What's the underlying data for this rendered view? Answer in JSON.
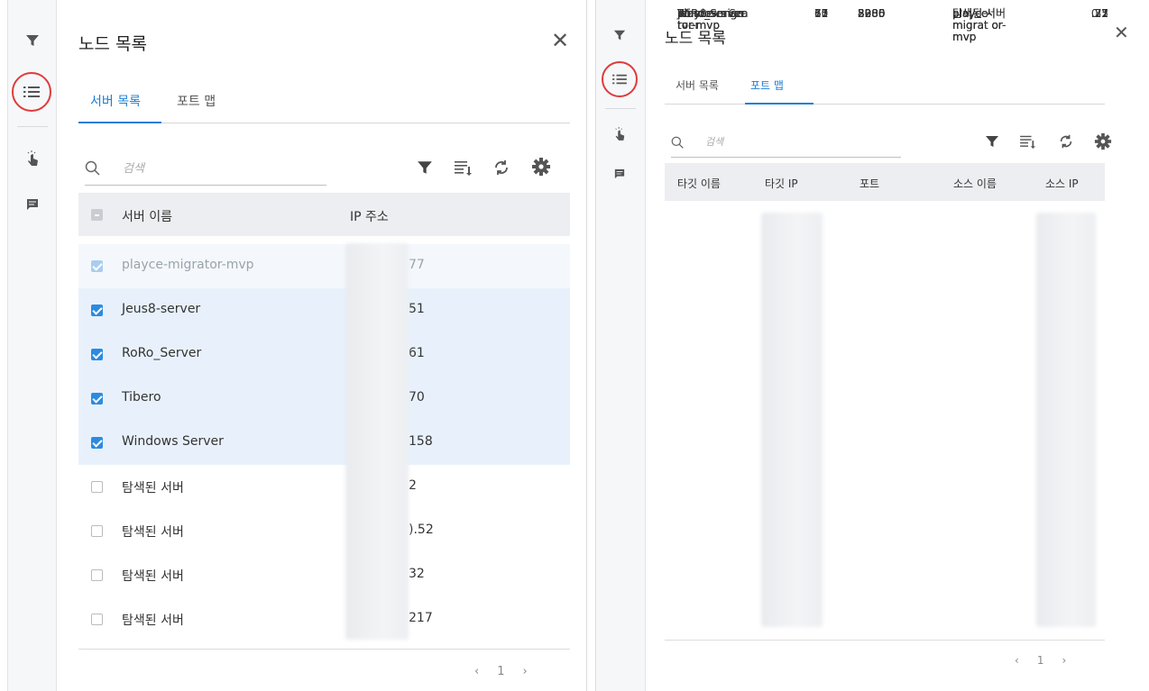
{
  "left": {
    "title": "노드 목록",
    "close": "✕",
    "tabs": [
      "서버 목록",
      "포트 맵"
    ],
    "active_tab": 0,
    "search_placeholder": "검색",
    "columns": [
      "서버 이름",
      "IP 주소"
    ],
    "rows": [
      {
        "name": "playce-migrator-mvp",
        "ip": "77",
        "state": "dim"
      },
      {
        "name": "Jeus8-server",
        "ip": "51",
        "state": "checked"
      },
      {
        "name": "RoRo_Server",
        "ip": "61",
        "state": "checked"
      },
      {
        "name": "Tibero",
        "ip": "70",
        "state": "checked"
      },
      {
        "name": "Windows Server",
        "ip": "158",
        "state": "checked"
      },
      {
        "name": "탐색된 서버",
        "ip": "2",
        "state": "unchecked"
      },
      {
        "name": "탐색된 서버",
        "ip": ").52",
        "state": "unchecked"
      },
      {
        "name": "탐색된 서버",
        "ip": "32",
        "state": "unchecked"
      },
      {
        "name": "탐색된 서버",
        "ip": "217",
        "state": "unchecked"
      }
    ],
    "pager": {
      "prev": "‹",
      "page": "1",
      "next": "›"
    }
  },
  "right": {
    "title": "노드 목록",
    "close": "✕",
    "tabs": [
      "서버 목록",
      "포트 맵"
    ],
    "active_tab": 1,
    "search_placeholder": "검색",
    "columns": [
      "타깃 이름",
      "타깃 IP",
      "포트",
      "소스 이름",
      "소스 IP"
    ],
    "rows": [
      {
        "target": "playce-migra tor-mvp",
        "tip": "77",
        "port": "8080",
        "source": "탐색된 서버",
        "sip": ".21"
      },
      {
        "target": "playce-migra tor-mvp",
        "tip": "77",
        "port": "8080",
        "source": "탐색된 서버",
        "sip": ".32"
      },
      {
        "target": "Windows Se rver",
        "tip": "15",
        "port": "5985",
        "source": "playce-migrat or-mvp",
        "sip": ".77"
      },
      {
        "target": "playce-migra tor-mvp",
        "tip": "77",
        "port": "8080",
        "source": "탐색된 서버",
        "sip": "0.5"
      },
      {
        "target": "playce-migra tor-mvp",
        "tip": "77",
        "port": "8080",
        "source": "탐색된 서버",
        "sip": ".2"
      },
      {
        "target": "Jeus8-server",
        "tip": "51",
        "port": "22",
        "source": "playce-migrat or-mvp",
        "sip": ".77"
      },
      {
        "target": "RoRo_Server",
        "tip": "61",
        "port": "3306",
        "source": "playce-migrat or-mvp",
        "sip": ".77"
      },
      {
        "target": "RoRo_Server",
        "tip": "61",
        "port": "22",
        "source": "playce-migrat or-mvp",
        "sip": ".77"
      },
      {
        "target": "Tibero",
        "tip": "70",
        "port": "22",
        "source": "playce-migrat or-mvp",
        "sip": ".77"
      }
    ],
    "pager": {
      "prev": "‹",
      "page": "1",
      "next": "›"
    }
  },
  "colors": {
    "accent": "#1e7fd3",
    "selected_row": "#e8f1fb",
    "highlight_ring": "#e03a3a",
    "header_bg": "#eceef1"
  },
  "icons": [
    "filter-icon",
    "list-icon",
    "touch-icon",
    "comment-icon",
    "search-icon",
    "column-settings-icon",
    "refresh-icon",
    "gear-icon",
    "close-icon"
  ]
}
